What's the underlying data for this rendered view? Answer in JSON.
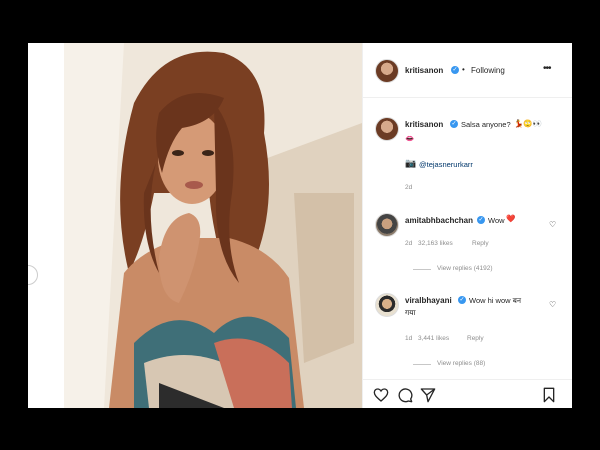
{
  "post": {
    "author": "kritisanon",
    "follow_state": "Following",
    "separator": "•"
  },
  "caption": {
    "username": "kritisanon",
    "text": "Salsa anyone?",
    "emojis": "💃🙄👀",
    "emoji_line2": "👄",
    "credit_handle": "@tejasnerurkarr",
    "age": "2d"
  },
  "comments": [
    {
      "username": "amitabhbachchan",
      "text": "Wow",
      "emoji": "❤️",
      "age": "2d",
      "likes": "32,163 likes",
      "reply": "Reply",
      "view_replies": "View replies (4192)"
    },
    {
      "username": "viralbhayani",
      "text_line1": "Wow hi wow बन",
      "text_line2": "गया",
      "age": "1d",
      "likes": "3,441 likes",
      "reply": "Reply",
      "view_replies": "View replies (88)"
    }
  ],
  "actions": {
    "like_icon": "heart-icon",
    "comment_icon": "comment-icon",
    "share_icon": "share-icon",
    "save_icon": "bookmark-icon"
  },
  "colors": {
    "verified": "#3897f0",
    "text": "#262626",
    "muted": "#8e8e8e",
    "link": "#00376b"
  }
}
